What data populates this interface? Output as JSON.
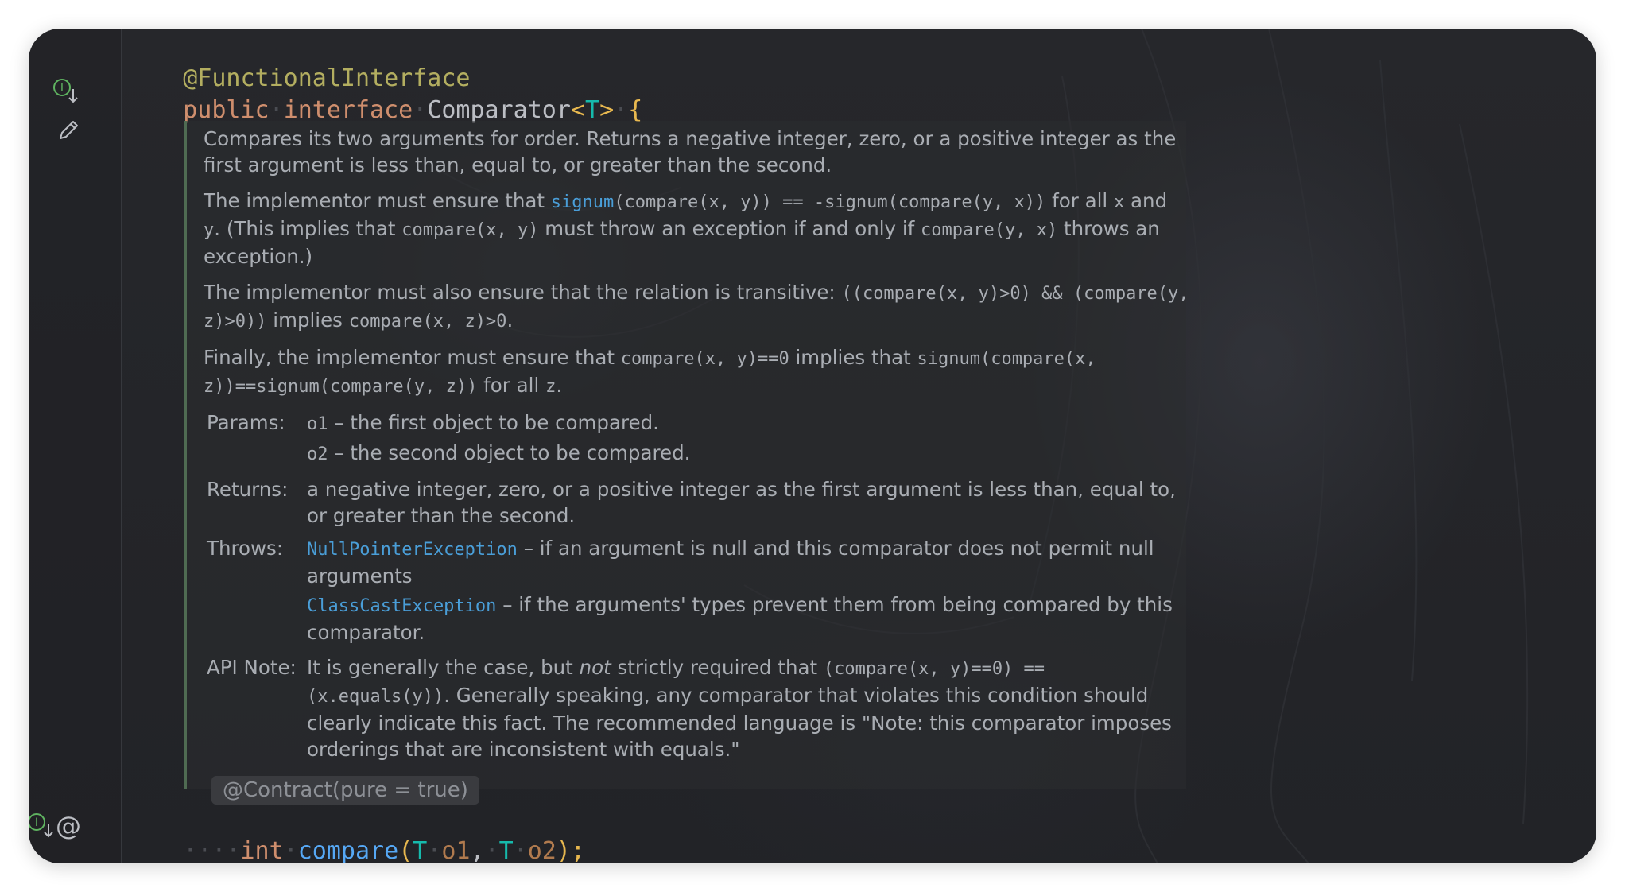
{
  "editor": {
    "line1": {
      "annotation": "@FunctionalInterface"
    },
    "line2": {
      "kw_public": "public",
      "kw_interface": "interface",
      "class_name": "Comparator",
      "lt": "<",
      "type_param": "T",
      "gt": ">",
      "brace": "{"
    },
    "method": {
      "indent_dots": "····",
      "return_type": "int",
      "name": "compare",
      "open_paren": "(",
      "p1_type": "T",
      "p1_name": "o1",
      "comma": ",",
      "p2_type": "T",
      "p2_name": "o2",
      "close": ");"
    },
    "contract_hint": "@Contract(pure = true)"
  },
  "gutter": {
    "icons": [
      "implemented-icon",
      "edit-icon",
      "implementing-icon",
      "at-sign-icon"
    ]
  },
  "javadoc": {
    "p1": "Compares its two arguments for order. Returns a negative integer, zero, or a positive integer as the first argument is less than, equal to, or greater than the second.",
    "p2": {
      "t1": "The implementor must ensure that ",
      "signum_link": "signum",
      "c1": "(compare(x, y)) == -signum(compare(y, x))",
      "t2": " for all ",
      "c2": "x",
      "t3": " and ",
      "c3": "y",
      "t4": ". (This implies that ",
      "c4": "compare(x, y)",
      "t5": " must throw an exception if and only if ",
      "c5": "compare(y, x)",
      "t6": " throws an exception.)"
    },
    "p3": {
      "t1": "The implementor must also ensure that the relation is transitive: ",
      "c1": "((compare(x, y)>0) && (compare(y, z)>0))",
      "t2": " implies ",
      "c2": "compare(x, z)>0",
      "t3": "."
    },
    "p4": {
      "t1": "Finally, the implementor must ensure that ",
      "c1": "compare(x, y)==0",
      "t2": " implies that ",
      "c2": "signum(compare(x, z))==signum(compare(y, z))",
      "t3": " for all ",
      "c3": "z",
      "t4": "."
    },
    "params_label": "Params:",
    "params": [
      {
        "name": "o1",
        "desc": " – the first object to be compared."
      },
      {
        "name": "o2",
        "desc": " – the second object to be compared."
      }
    ],
    "returns_label": "Returns:",
    "returns": "a negative integer, zero, or a positive integer as the first argument is less than, equal to, or greater than the second.",
    "throws_label": "Throws:",
    "throws": [
      {
        "name": "NullPointerException",
        "desc": " – if an argument is null and this comparator does not permit null arguments"
      },
      {
        "name": "ClassCastException",
        "desc": " – if the arguments' types prevent them from being compared by this comparator."
      }
    ],
    "apinote_label": "API Note:",
    "apinote": {
      "t1": "It is generally the case, but ",
      "em": "not",
      "t2": " strictly required that ",
      "c1": "(compare(x, y)==0) == (x.equals(y))",
      "t3": ". Generally speaking, any comparator that violates this condition should clearly indicate this fact. The recommended language is \"Note: this comparator imposes orderings that are inconsistent with equals.\""
    }
  },
  "colors": {
    "background": "#232427",
    "annotation": "#b3ae60",
    "keyword": "#cf8e6d",
    "type_param": "#16baac",
    "function": "#56a8f5",
    "link": "#4a9ed8",
    "doc_text": "#a9adb3"
  }
}
